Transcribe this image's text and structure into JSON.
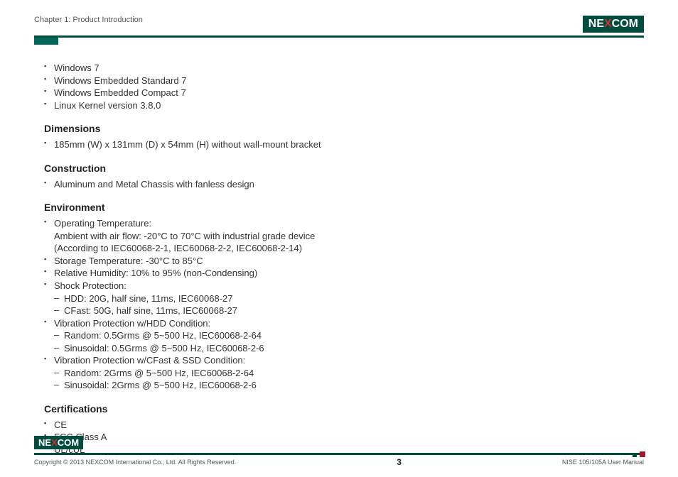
{
  "header": {
    "chapter": "Chapter 1: Product Introduction",
    "logo_text_left": "NE",
    "logo_text_x": "X",
    "logo_text_right": "COM"
  },
  "os_support": [
    "Windows 7",
    "Windows Embedded Standard 7",
    "Windows Embedded Compact 7",
    "Linux Kernel version 3.8.0"
  ],
  "sections": {
    "dimensions": {
      "title": "Dimensions",
      "items": [
        "185mm (W) x 131mm (D) x 54mm (H) without wall-mount bracket"
      ]
    },
    "construction": {
      "title": "Construction",
      "items": [
        "Aluminum and Metal Chassis with fanless design"
      ]
    },
    "environment": {
      "title": "Environment",
      "op_temp_l1": "Operating Temperature:",
      "op_temp_l2": "Ambient with air flow: -20°C to 70°C with industrial grade device",
      "op_temp_l3": "(According to IEC60068-2-1, IEC60068-2-2, IEC60068-2-14)",
      "storage_temp": "Storage Temperature: -30°C to 85°C",
      "humidity": "Relative Humidity: 10% to 95% (non-Condensing)",
      "shock_title": "Shock Protection:",
      "shock_hdd": "HDD: 20G, half sine, 11ms, IEC60068-27",
      "shock_cfast": "CFast: 50G, half sine, 11ms, IEC60068-27",
      "vib_hdd_title": "Vibration Protection w/HDD Condition:",
      "vib_hdd_random": "Random: 0.5Grms @ 5~500 Hz, IEC60068-2-64",
      "vib_hdd_sin": "Sinusoidal: 0.5Grms @ 5~500 Hz, IEC60068-2-6",
      "vib_ssd_title": "Vibration Protection w/CFast & SSD Condition:",
      "vib_ssd_random": "Random: 2Grms @ 5~500 Hz, IEC60068-2-64",
      "vib_ssd_sin": "Sinusoidal: 2Grms @ 5~500 Hz, IEC60068-2-6"
    },
    "certifications": {
      "title": "Certifications",
      "items": [
        "CE",
        "FCC Class A",
        "UL/cUL"
      ]
    }
  },
  "footer": {
    "copyright": "Copyright © 2013 NEXCOM International Co., Ltd. All Rights Reserved.",
    "page": "3",
    "doc": "NISE 105/105A User Manual"
  }
}
